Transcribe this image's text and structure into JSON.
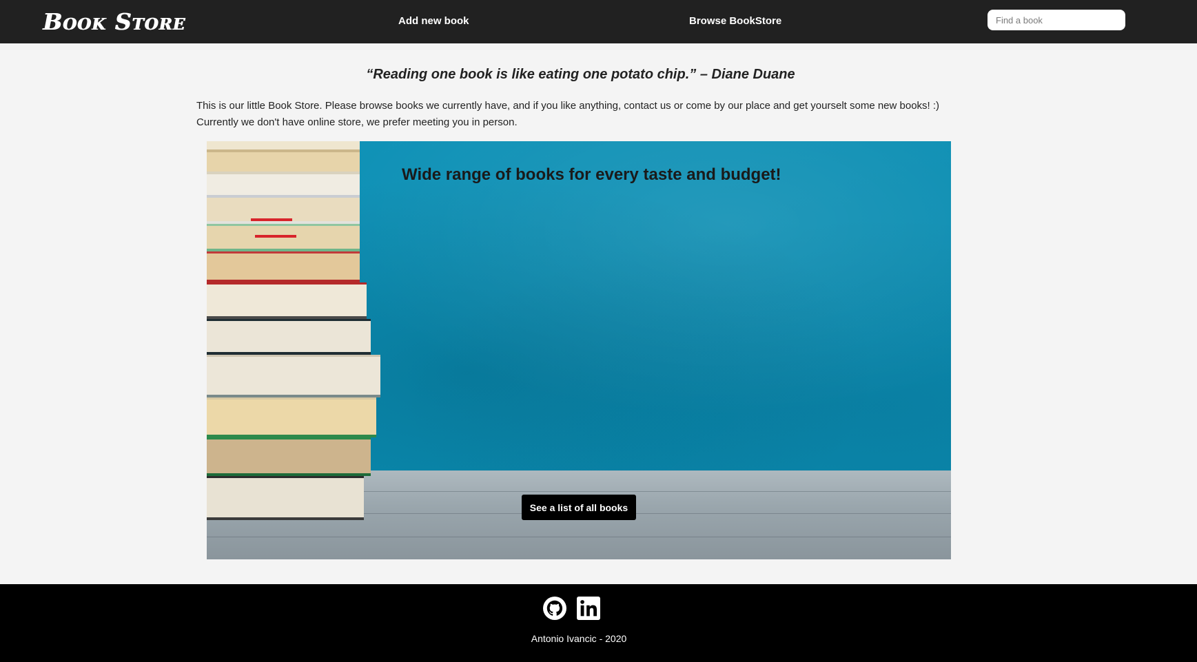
{
  "navbar": {
    "brand": "Book Store",
    "links": {
      "add_book": "Add new book",
      "browse": "Browse BookStore"
    },
    "search": {
      "placeholder": "Find a book",
      "value": ""
    }
  },
  "main": {
    "quote": "“Reading one book is like eating one potato chip.” – Diane Duane",
    "intro_line1": "This is our little Book Store. Please browse books we currently have, and if you like anything, contact us or come by our place and get yourselt some new books! :)",
    "intro_line2": "Currently we don't have online store, we prefer meeting you in person."
  },
  "hero": {
    "title": "Wide range of books for every taste and budget!",
    "button_label": "See a list of all books"
  },
  "footer": {
    "icons": [
      "github-icon",
      "linkedin-icon"
    ],
    "copyright": "Antonio Ivancic - 2020"
  },
  "colors": {
    "navbar_bg": "#212121",
    "page_bg": "#f4f4f4",
    "hero_bg": "#0b8db2",
    "footer_bg": "#000000",
    "button_bg": "#000000"
  }
}
